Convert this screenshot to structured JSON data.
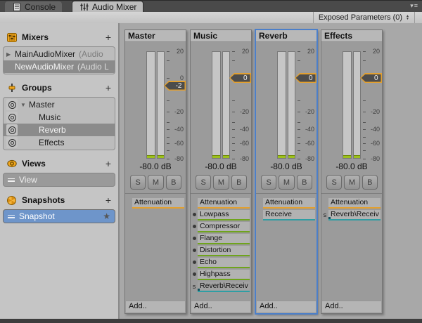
{
  "window": {
    "menu_icon": "▾≡"
  },
  "tabs": {
    "console": {
      "label": "Console"
    },
    "audio_mixer": {
      "label": "Audio Mixer"
    }
  },
  "toolbar": {
    "exposed_parameters_label": "Exposed Parameters (0)"
  },
  "sidebar": {
    "mixers": {
      "title": "Mixers",
      "add_label": "+",
      "items": [
        {
          "label": "MainAudioMixer",
          "suffix": "(Audio"
        },
        {
          "label": "NewAudioMixer",
          "suffix": "(Audio L"
        }
      ]
    },
    "groups": {
      "title": "Groups",
      "add_label": "+",
      "items": [
        {
          "label": "Master"
        },
        {
          "label": "Music"
        },
        {
          "label": "Reverb"
        },
        {
          "label": "Effects"
        }
      ]
    },
    "views": {
      "title": "Views",
      "add_label": "+",
      "items": [
        {
          "label": "View"
        }
      ]
    },
    "snapshots": {
      "title": "Snapshots",
      "add_label": "+",
      "items": [
        {
          "label": "Snapshot",
          "star": "★"
        }
      ]
    }
  },
  "scale": {
    "labels": [
      "20",
      "0",
      "-20",
      "-40",
      "-60",
      "-80"
    ]
  },
  "strip_buttons": {
    "solo": "S",
    "mute": "M",
    "bypass": "B"
  },
  "add_label": "Add..",
  "strips": [
    {
      "name": "Master",
      "fader_label": "-2",
      "volume": "-80.0 dB",
      "effects": [
        {
          "label": "Attenuation"
        }
      ]
    },
    {
      "name": "Music",
      "fader_label": "0",
      "volume": "-80.0 dB",
      "effects": [
        {
          "label": "Attenuation"
        },
        {
          "label": "Lowpass"
        },
        {
          "label": "Compressor"
        },
        {
          "label": "Flange"
        },
        {
          "label": "Distortion"
        },
        {
          "label": "Echo"
        },
        {
          "label": "Highpass"
        },
        {
          "label": "Reverb\\Receiv",
          "prefix": "s"
        }
      ]
    },
    {
      "name": "Reverb",
      "fader_label": "0",
      "volume": "-80.0 dB",
      "effects": [
        {
          "label": "Attenuation"
        },
        {
          "label": "Receive"
        }
      ]
    },
    {
      "name": "Effects",
      "fader_label": "0",
      "volume": "-80.0 dB",
      "effects": [
        {
          "label": "Attenuation"
        },
        {
          "label": "Reverb\\Receiv",
          "prefix": "s"
        }
      ]
    }
  ],
  "colors": {
    "accent_orange": "#E2A031",
    "effect_green": "#6FA41C",
    "effect_teal": "#2E9EA4",
    "selection_blue": "#6E95CA",
    "strip_select_blue": "#4C7FC9",
    "meter_green": "#9CC11C"
  }
}
